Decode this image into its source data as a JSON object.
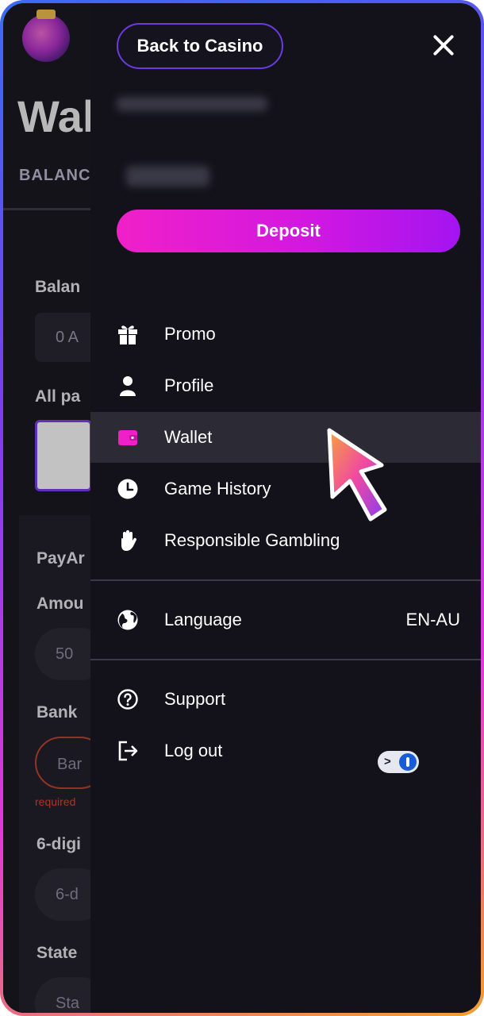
{
  "background_page": {
    "title": "Wal",
    "tab": "BALANC",
    "balance_label": "Balan",
    "balance_value": "0 A",
    "all_payments_label": "All pa",
    "payment_method_label": "PayAr",
    "amount_label": "Amou",
    "amount_value": "50",
    "bank_label": "Bank",
    "bank_placeholder": "Bar",
    "required_text": "required",
    "six_digit_label": "6-digi",
    "six_digit_placeholder": "6-d",
    "state_label": "State",
    "state_placeholder": "Sta"
  },
  "drawer": {
    "back_label": "Back to Casino",
    "deposit_label": "Deposit",
    "menu": [
      {
        "label": "Promo",
        "icon": "gift-icon"
      },
      {
        "label": "Profile",
        "icon": "user-icon"
      },
      {
        "label": "Wallet",
        "icon": "wallet-icon",
        "active": true
      },
      {
        "label": "Game History",
        "icon": "clock-icon"
      },
      {
        "label": "Responsible Gambling",
        "icon": "hand-icon"
      }
    ],
    "language": {
      "label": "Language",
      "value": "EN-AU",
      "icon": "globe-icon"
    },
    "support_label": "Support",
    "logout_label": "Log out"
  },
  "colors": {
    "accent_pink": "#f020c8",
    "accent_purple": "#a414f0",
    "active_item_bg": "#2c2b35",
    "drawer_bg": "#13121a"
  }
}
